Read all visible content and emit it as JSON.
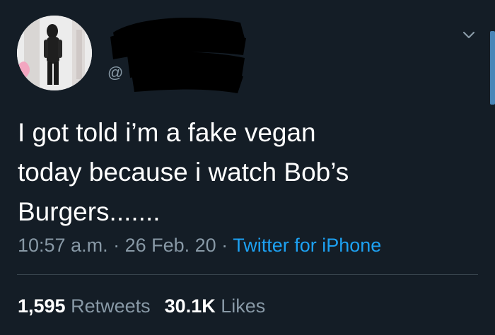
{
  "tweet": {
    "handle_prefix": "@",
    "text": "I got told i’m a fake vegan\ntoday because i watch Bob’s\nBurgers.......",
    "time": "10:57 a.m.",
    "separator": " · ",
    "date": "26 Feb. 20",
    "source": "Twitter for iPhone"
  },
  "stats": {
    "retweets_count": "1,595",
    "retweets_label": "Retweets",
    "likes_count": "30.1K",
    "likes_label": "Likes"
  },
  "colors": {
    "background": "#141d26",
    "text": "#ffffff",
    "muted": "#8899a6",
    "link": "#1da1f2",
    "divider": "#38444d"
  },
  "icons": [
    "avatar-photo",
    "chevron-down-icon"
  ]
}
